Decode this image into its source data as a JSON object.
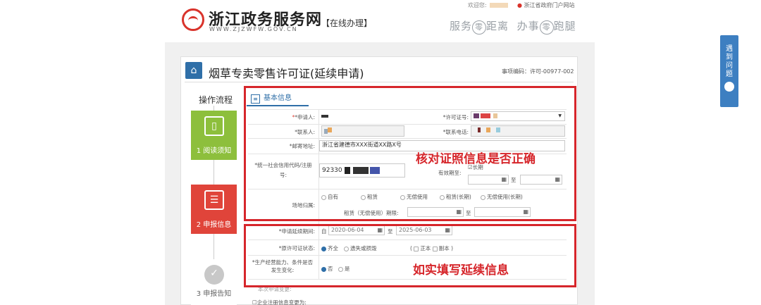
{
  "header": {
    "site_name": "浙江政务服务网",
    "site_url": "WWW.ZJZWFW.GOV.CN",
    "tag": "【在线办理】",
    "welcome": "欢迎您:",
    "portal_link": "浙江省政府门户网站",
    "slogan_parts": [
      "服务",
      "零",
      "距离",
      "办事",
      "零",
      "跑腿"
    ]
  },
  "form": {
    "title": "烟草专卖零售许可证(延续申请)",
    "item_code": "事项编码：许可-00977-002",
    "flow_label": "操作流程",
    "steps": [
      {
        "label": "1 阅读须知"
      },
      {
        "label": "2 申报信息"
      },
      {
        "label": "3 申报告知"
      }
    ],
    "section_label": "基本信息"
  },
  "fields": {
    "applicant": "*申请人:",
    "license_no": "*许可证号:",
    "contact": "*联系人:",
    "contact_phone": "*联系电话:",
    "mail_address": "*邮寄地址:",
    "mail_address_value": "浙江省建德市XXX街道XX路X号",
    "credit_code": "*统一社会信用代码/注册号:",
    "credit_code_value": "92330",
    "valid_period": "有效期至:",
    "long_term": "长期",
    "date_sep": "至",
    "venue_label": "场地归属:",
    "venue_options": [
      "自有",
      "租赁",
      "无偿使用",
      "租赁(长期)",
      "无偿使用(长期)"
    ],
    "lease_period": "租赁（无偿使用）期限:",
    "renew_period": "*申请延续期间:",
    "renew_from_prefix": "自",
    "renew_from": "2020-06-04",
    "renew_to": "2025-06-03",
    "license_status": "*原许可证状态:",
    "status_options": [
      "齐全",
      "遗失或损毁"
    ],
    "copy_options": [
      "正本",
      "副本"
    ],
    "capacity_change": "*生产经营能力、条件是否发生变化:",
    "yes_no": [
      "否",
      "是"
    ],
    "cut_row_1": "本次申请变更:",
    "cut_row_2": "企业注册信息变更为:"
  },
  "annotations": {
    "check": "核对证照信息是否正确",
    "fill": "如实填写延续信息"
  },
  "side_widget": {
    "text": "遇到问题"
  },
  "colors": {
    "accent": "#2f6fa8",
    "red": "#d6262b",
    "green": "#8dbf3c"
  }
}
